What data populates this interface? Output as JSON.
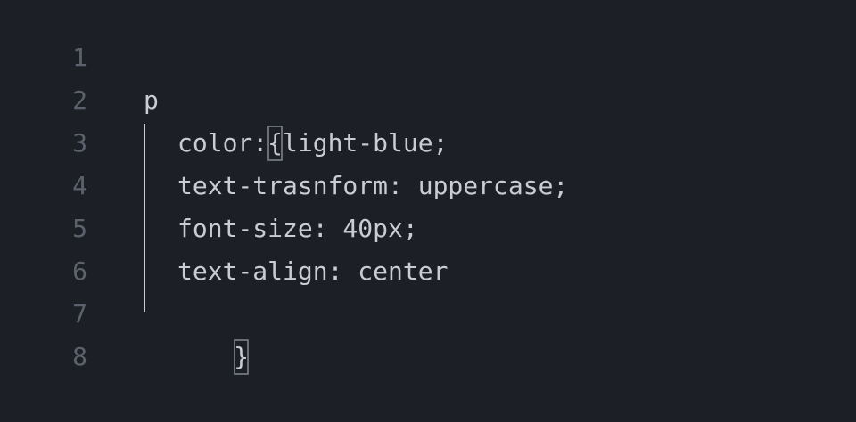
{
  "editor": {
    "lines": [
      {
        "num": "1",
        "text": ""
      },
      {
        "num": "2",
        "text": ""
      },
      {
        "num": "3",
        "selector": "p",
        "brace": "{"
      },
      {
        "num": "4",
        "text": "color: light-blue;"
      },
      {
        "num": "5",
        "text": "text-trasnform: uppercase;"
      },
      {
        "num": "6",
        "text": "font-size: 40px;"
      },
      {
        "num": "7",
        "text": "text-align: center"
      },
      {
        "num": "8",
        "brace": "}"
      }
    ]
  },
  "colors": {
    "background": "#1c1f26",
    "text": "#c9cdd3",
    "line_number": "#5c616b",
    "bracket_highlight": "#6a6e76"
  }
}
